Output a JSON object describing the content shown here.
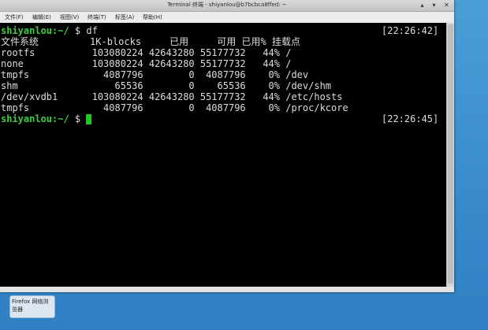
{
  "window": {
    "title": "Terminal 终端 - shiyanlou@b7bcbca8ffed: ~",
    "controls": [
      "▴",
      "▾",
      "✕"
    ]
  },
  "menu": [
    {
      "label": "文件(F)"
    },
    {
      "label": "编辑(E)"
    },
    {
      "label": "视图(V)"
    },
    {
      "label": "终端(T)"
    },
    {
      "label": "标签(A)"
    },
    {
      "label": "帮助(H)"
    }
  ],
  "terminal": {
    "prompt1": "shiyanlou:~/",
    "cmd1": " $ df",
    "time1": "[22:26:42]",
    "header": "文件系统         1K-blocks     已用     可用 已用% 挂载点",
    "rows": [
      "rootfs          103080224 42643280 55177732   44% /",
      "none            103080224 42643280 55177732   44% /",
      "tmpfs             4087796        0  4087796    0% /dev",
      "shm                 65536        0    65536    0% /dev/shm",
      "/dev/xvdb1      103080224 42643280 55177732   44% /etc/hosts",
      "tmpfs             4087796        0  4087796    0% /proc/kcore"
    ],
    "prompt2": "shiyanlou:~/",
    "cmd2": " $ ",
    "time2": "[22:26:45]"
  },
  "desktop": {
    "firefox_label": "Firefox 网络浏览器"
  }
}
